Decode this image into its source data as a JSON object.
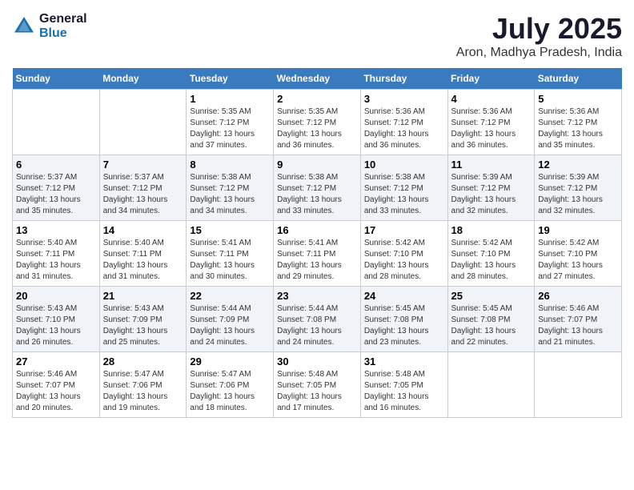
{
  "logo": {
    "general": "General",
    "blue": "Blue"
  },
  "title": "July 2025",
  "subtitle": "Aron, Madhya Pradesh, India",
  "days_of_week": [
    "Sunday",
    "Monday",
    "Tuesday",
    "Wednesday",
    "Thursday",
    "Friday",
    "Saturday"
  ],
  "weeks": [
    [
      {
        "day": "",
        "sunrise": "",
        "sunset": "",
        "daylight": ""
      },
      {
        "day": "",
        "sunrise": "",
        "sunset": "",
        "daylight": ""
      },
      {
        "day": "1",
        "sunrise": "Sunrise: 5:35 AM",
        "sunset": "Sunset: 7:12 PM",
        "daylight": "Daylight: 13 hours and 37 minutes."
      },
      {
        "day": "2",
        "sunrise": "Sunrise: 5:35 AM",
        "sunset": "Sunset: 7:12 PM",
        "daylight": "Daylight: 13 hours and 36 minutes."
      },
      {
        "day": "3",
        "sunrise": "Sunrise: 5:36 AM",
        "sunset": "Sunset: 7:12 PM",
        "daylight": "Daylight: 13 hours and 36 minutes."
      },
      {
        "day": "4",
        "sunrise": "Sunrise: 5:36 AM",
        "sunset": "Sunset: 7:12 PM",
        "daylight": "Daylight: 13 hours and 36 minutes."
      },
      {
        "day": "5",
        "sunrise": "Sunrise: 5:36 AM",
        "sunset": "Sunset: 7:12 PM",
        "daylight": "Daylight: 13 hours and 35 minutes."
      }
    ],
    [
      {
        "day": "6",
        "sunrise": "Sunrise: 5:37 AM",
        "sunset": "Sunset: 7:12 PM",
        "daylight": "Daylight: 13 hours and 35 minutes."
      },
      {
        "day": "7",
        "sunrise": "Sunrise: 5:37 AM",
        "sunset": "Sunset: 7:12 PM",
        "daylight": "Daylight: 13 hours and 34 minutes."
      },
      {
        "day": "8",
        "sunrise": "Sunrise: 5:38 AM",
        "sunset": "Sunset: 7:12 PM",
        "daylight": "Daylight: 13 hours and 34 minutes."
      },
      {
        "day": "9",
        "sunrise": "Sunrise: 5:38 AM",
        "sunset": "Sunset: 7:12 PM",
        "daylight": "Daylight: 13 hours and 33 minutes."
      },
      {
        "day": "10",
        "sunrise": "Sunrise: 5:38 AM",
        "sunset": "Sunset: 7:12 PM",
        "daylight": "Daylight: 13 hours and 33 minutes."
      },
      {
        "day": "11",
        "sunrise": "Sunrise: 5:39 AM",
        "sunset": "Sunset: 7:12 PM",
        "daylight": "Daylight: 13 hours and 32 minutes."
      },
      {
        "day": "12",
        "sunrise": "Sunrise: 5:39 AM",
        "sunset": "Sunset: 7:12 PM",
        "daylight": "Daylight: 13 hours and 32 minutes."
      }
    ],
    [
      {
        "day": "13",
        "sunrise": "Sunrise: 5:40 AM",
        "sunset": "Sunset: 7:11 PM",
        "daylight": "Daylight: 13 hours and 31 minutes."
      },
      {
        "day": "14",
        "sunrise": "Sunrise: 5:40 AM",
        "sunset": "Sunset: 7:11 PM",
        "daylight": "Daylight: 13 hours and 31 minutes."
      },
      {
        "day": "15",
        "sunrise": "Sunrise: 5:41 AM",
        "sunset": "Sunset: 7:11 PM",
        "daylight": "Daylight: 13 hours and 30 minutes."
      },
      {
        "day": "16",
        "sunrise": "Sunrise: 5:41 AM",
        "sunset": "Sunset: 7:11 PM",
        "daylight": "Daylight: 13 hours and 29 minutes."
      },
      {
        "day": "17",
        "sunrise": "Sunrise: 5:42 AM",
        "sunset": "Sunset: 7:10 PM",
        "daylight": "Daylight: 13 hours and 28 minutes."
      },
      {
        "day": "18",
        "sunrise": "Sunrise: 5:42 AM",
        "sunset": "Sunset: 7:10 PM",
        "daylight": "Daylight: 13 hours and 28 minutes."
      },
      {
        "day": "19",
        "sunrise": "Sunrise: 5:42 AM",
        "sunset": "Sunset: 7:10 PM",
        "daylight": "Daylight: 13 hours and 27 minutes."
      }
    ],
    [
      {
        "day": "20",
        "sunrise": "Sunrise: 5:43 AM",
        "sunset": "Sunset: 7:10 PM",
        "daylight": "Daylight: 13 hours and 26 minutes."
      },
      {
        "day": "21",
        "sunrise": "Sunrise: 5:43 AM",
        "sunset": "Sunset: 7:09 PM",
        "daylight": "Daylight: 13 hours and 25 minutes."
      },
      {
        "day": "22",
        "sunrise": "Sunrise: 5:44 AM",
        "sunset": "Sunset: 7:09 PM",
        "daylight": "Daylight: 13 hours and 24 minutes."
      },
      {
        "day": "23",
        "sunrise": "Sunrise: 5:44 AM",
        "sunset": "Sunset: 7:08 PM",
        "daylight": "Daylight: 13 hours and 24 minutes."
      },
      {
        "day": "24",
        "sunrise": "Sunrise: 5:45 AM",
        "sunset": "Sunset: 7:08 PM",
        "daylight": "Daylight: 13 hours and 23 minutes."
      },
      {
        "day": "25",
        "sunrise": "Sunrise: 5:45 AM",
        "sunset": "Sunset: 7:08 PM",
        "daylight": "Daylight: 13 hours and 22 minutes."
      },
      {
        "day": "26",
        "sunrise": "Sunrise: 5:46 AM",
        "sunset": "Sunset: 7:07 PM",
        "daylight": "Daylight: 13 hours and 21 minutes."
      }
    ],
    [
      {
        "day": "27",
        "sunrise": "Sunrise: 5:46 AM",
        "sunset": "Sunset: 7:07 PM",
        "daylight": "Daylight: 13 hours and 20 minutes."
      },
      {
        "day": "28",
        "sunrise": "Sunrise: 5:47 AM",
        "sunset": "Sunset: 7:06 PM",
        "daylight": "Daylight: 13 hours and 19 minutes."
      },
      {
        "day": "29",
        "sunrise": "Sunrise: 5:47 AM",
        "sunset": "Sunset: 7:06 PM",
        "daylight": "Daylight: 13 hours and 18 minutes."
      },
      {
        "day": "30",
        "sunrise": "Sunrise: 5:48 AM",
        "sunset": "Sunset: 7:05 PM",
        "daylight": "Daylight: 13 hours and 17 minutes."
      },
      {
        "day": "31",
        "sunrise": "Sunrise: 5:48 AM",
        "sunset": "Sunset: 7:05 PM",
        "daylight": "Daylight: 13 hours and 16 minutes."
      },
      {
        "day": "",
        "sunrise": "",
        "sunset": "",
        "daylight": ""
      },
      {
        "day": "",
        "sunrise": "",
        "sunset": "",
        "daylight": ""
      }
    ]
  ]
}
